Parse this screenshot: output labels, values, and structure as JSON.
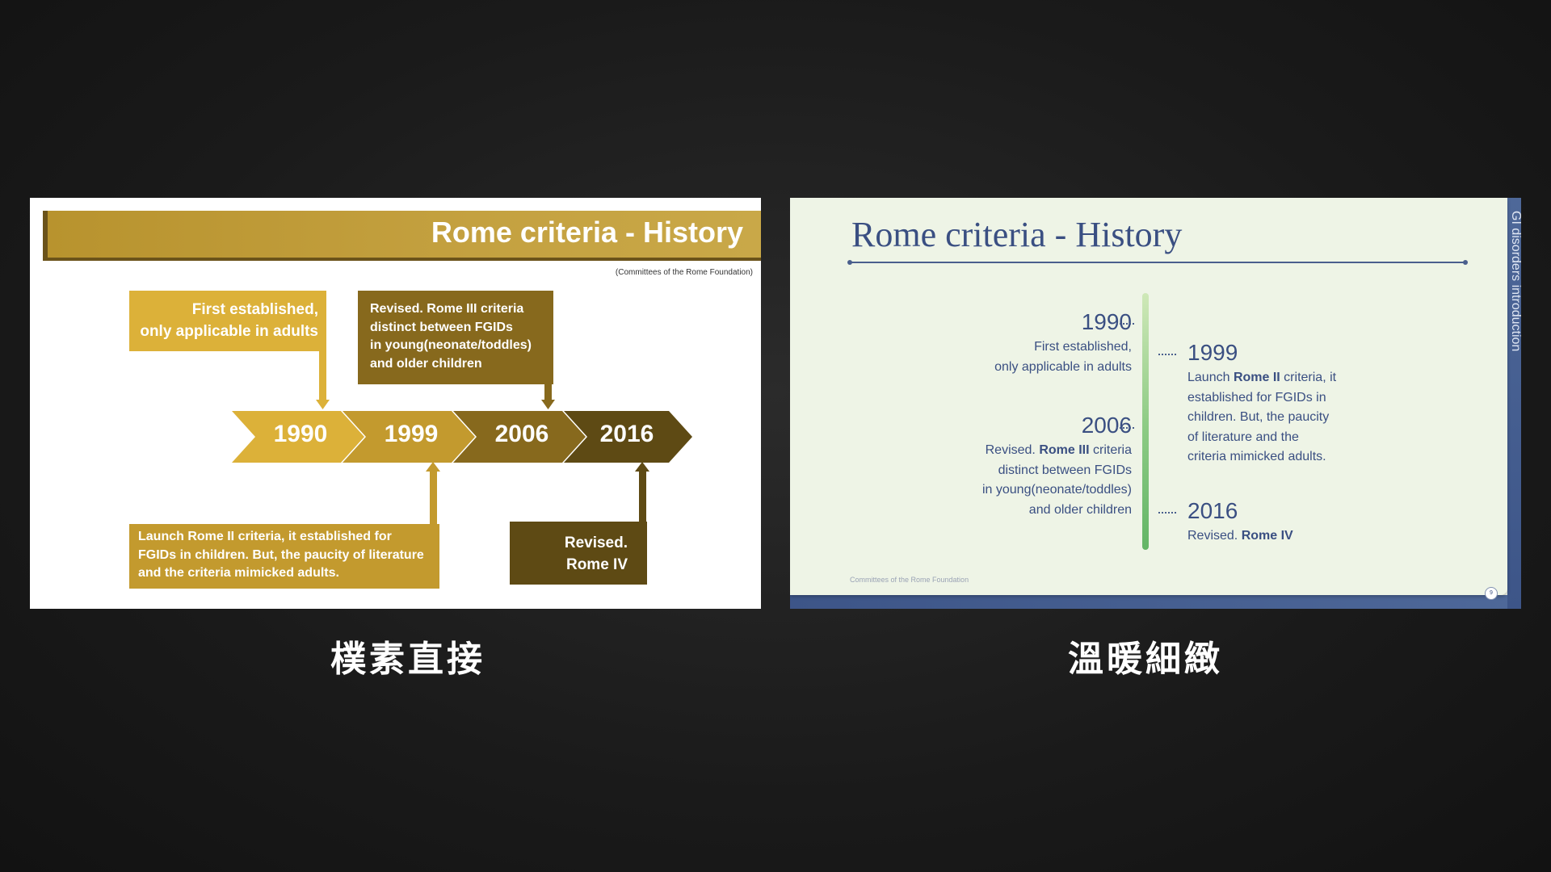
{
  "left_slide": {
    "title": "Rome criteria - History",
    "source": "(Committees of the Rome Foundation)",
    "box_1990": [
      "First established,",
      "only applicable in adults"
    ],
    "box_2006": [
      "Revised. Rome III criteria",
      "distinct between FGIDs",
      "in young(neonate/toddles)",
      "and older children"
    ],
    "box_1999": [
      "Launch Rome II criteria, it established for",
      "FGIDs in children. But, the paucity of literature",
      "and the criteria mimicked adults."
    ],
    "box_2016": [
      "Revised.",
      "Rome IV"
    ],
    "years": [
      "1990",
      "1999",
      "2006",
      "2016"
    ],
    "colors": {
      "banner": "#c4a140",
      "chevron_1990": "#dcb139",
      "chevron_1999": "#c39a2e",
      "chevron_2006": "#87691d",
      "chevron_2016": "#5e4a14"
    }
  },
  "right_slide": {
    "title": "Rome criteria - History",
    "side_label": "GI disorders introduction",
    "source": "Committees of the Rome Foundation",
    "page_number": "9",
    "entries": {
      "e1990": {
        "year": "1990",
        "lines": [
          "First established,",
          "only applicable in adults"
        ]
      },
      "e1999": {
        "year": "1999",
        "pre": "Launch ",
        "bold": "Rome II",
        "post": " criteria, it",
        "lines": [
          "established for FGIDs in",
          "children. But, the paucity",
          "of literature and the",
          "criteria mimicked adults."
        ]
      },
      "e2006": {
        "year": "2006",
        "pre": "Revised. ",
        "bold": "Rome III",
        "post": " criteria",
        "lines": [
          "distinct between FGIDs",
          "in young(neonate/toddles)",
          "and older children"
        ]
      },
      "e2016": {
        "year": "2016",
        "pre": "Revised. ",
        "bold": "Rome IV"
      }
    },
    "colors": {
      "background": "#eef4e6",
      "text": "#3a4f82",
      "accent_bar": "#4e6899",
      "timeline": "#63b566"
    }
  },
  "captions": {
    "left": "樸素直接",
    "right": "溫暖細緻"
  }
}
